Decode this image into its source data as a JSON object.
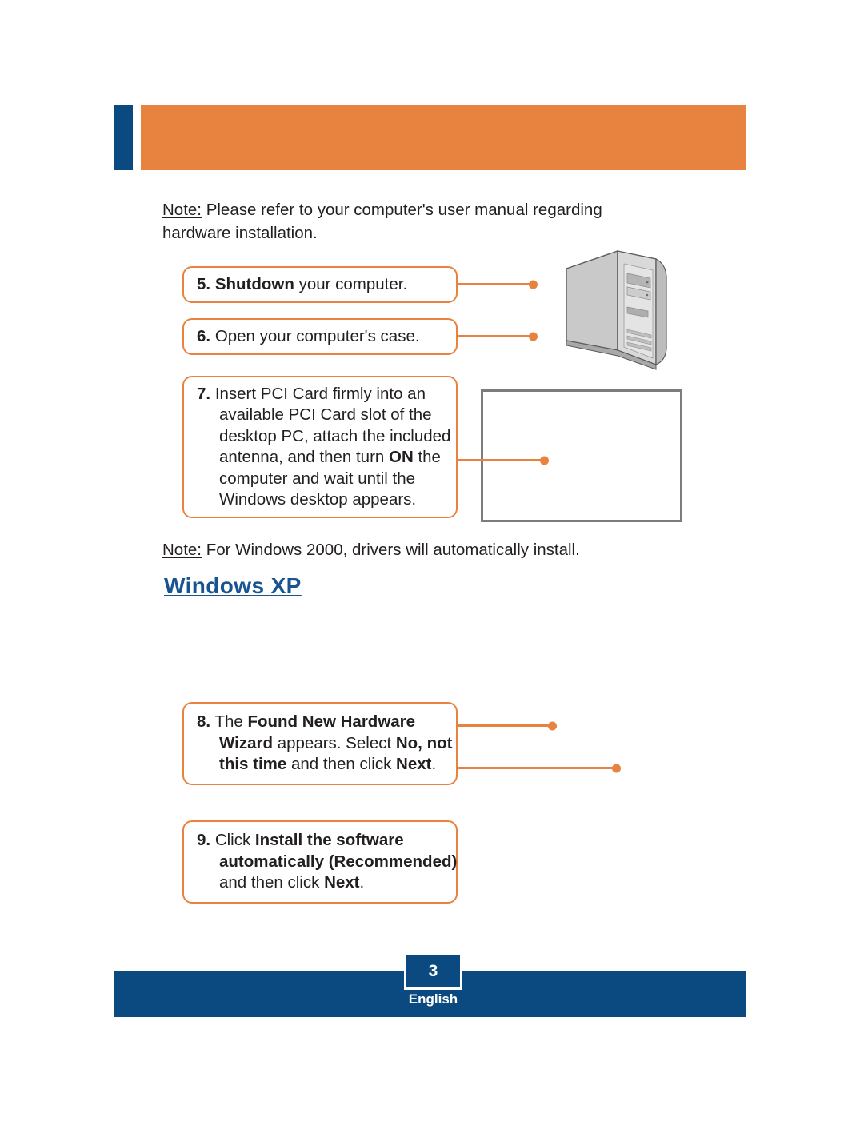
{
  "header": {
    "title": ""
  },
  "notes": {
    "hardware": {
      "label": "Note:",
      "text": " Please refer to your computer's user manual regarding hardware installation."
    },
    "windows2000": {
      "label": "Note:",
      "text": " For Windows 2000, drivers will automatically install."
    }
  },
  "section_heading": "Windows XP",
  "steps": [
    {
      "number": "5.",
      "lines": [
        [
          {
            "t": "Shutdown",
            "b": true
          },
          {
            "t": " your computer.",
            "b": false
          }
        ]
      ]
    },
    {
      "number": "6.",
      "lines": [
        [
          {
            "t": "Open your computer's case.",
            "b": false
          }
        ]
      ]
    },
    {
      "number": "7.",
      "lines": [
        [
          {
            "t": "Insert PCI Card firmly into an",
            "b": false
          }
        ],
        [
          {
            "t": "available PCI Card slot of the",
            "b": false
          }
        ],
        [
          {
            "t": "desktop PC, attach the included",
            "b": false
          }
        ],
        [
          {
            "t": "antenna, and then turn ",
            "b": false
          },
          {
            "t": "ON",
            "b": true
          },
          {
            "t": " the",
            "b": false
          }
        ],
        [
          {
            "t": "computer and wait until the",
            "b": false
          }
        ],
        [
          {
            "t": "Windows desktop appears.",
            "b": false
          }
        ]
      ]
    },
    {
      "number": "8.",
      "lines": [
        [
          {
            "t": "The ",
            "b": false
          },
          {
            "t": "Found New Hardware",
            "b": true
          }
        ],
        [
          {
            "t": "Wizard",
            "b": true
          },
          {
            "t": " appears. Select ",
            "b": false
          },
          {
            "t": "No, not",
            "b": true
          }
        ],
        [
          {
            "t": "this time",
            "b": true
          },
          {
            "t": " and then click ",
            "b": false
          },
          {
            "t": "Next",
            "b": true
          },
          {
            "t": ".",
            "b": false
          }
        ]
      ]
    },
    {
      "number": "9.",
      "lines": [
        [
          {
            "t": "Click ",
            "b": false
          },
          {
            "t": "Install the software",
            "b": true
          }
        ],
        [
          {
            "t": "automatically (Recommended)",
            "b": true
          }
        ],
        [
          {
            "t": "and then click ",
            "b": false
          },
          {
            "t": "Next",
            "b": true
          },
          {
            "t": ".",
            "b": false
          }
        ]
      ]
    }
  ],
  "footer": {
    "page_number": "3",
    "language": "English"
  },
  "colors": {
    "orange": "#e8833f",
    "blue": "#0a4a80",
    "heading_blue": "#1a5490",
    "gray_border": "#807b80",
    "text": "#231f20"
  }
}
